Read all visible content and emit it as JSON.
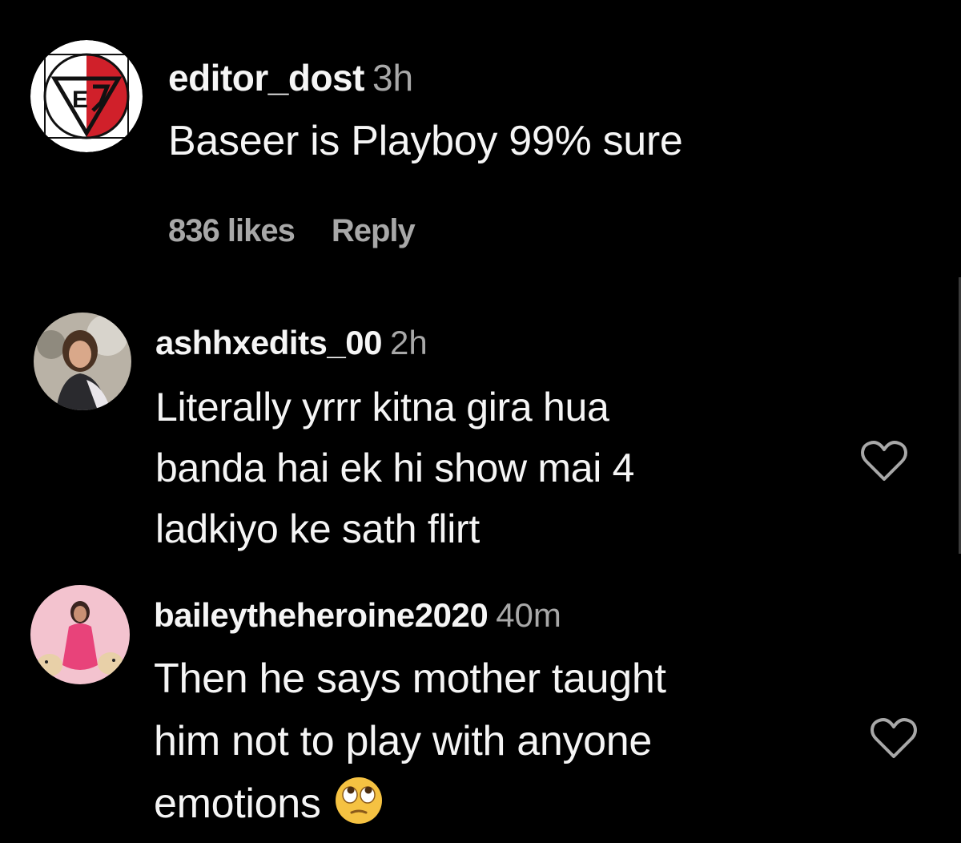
{
  "comments": [
    {
      "username": "editor_dost",
      "time": "3h",
      "lines": [
        "Baseer is Playboy 99% sure"
      ],
      "likes": "836 likes",
      "reply": "Reply",
      "avatar": "ed-logo-avatar"
    },
    {
      "username": "ashhxedits_00",
      "time": "2h",
      "lines": [
        "Literally yrrr kitna gira hua",
        "banda hai ek hi show mai 4",
        "ladkiyo ke sath flirt"
      ],
      "avatar": "profile-photo",
      "heart_icon": "heart-outline-icon"
    },
    {
      "username": "baileytheheroine2020",
      "time": "40m",
      "lines": [
        "Then he says mother taught",
        "him not to play with anyone",
        "emotions"
      ],
      "emoji": "face-with-rolling-eyes",
      "avatar": "profile-photo",
      "heart_icon": "heart-outline-icon"
    }
  ],
  "colors": {
    "background": "#000000",
    "primary_text": "#f5f5f5",
    "secondary_text": "#a8a8a8",
    "logo_red": "#d0202a"
  }
}
